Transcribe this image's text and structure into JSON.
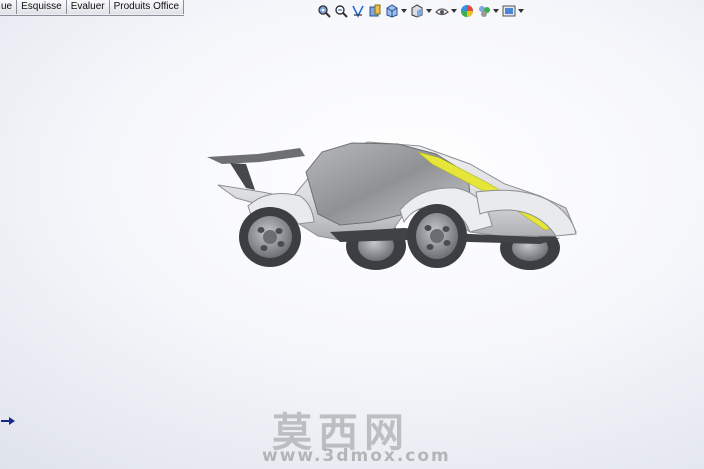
{
  "command_tabs": [
    {
      "label": "ue"
    },
    {
      "label": "Esquisse"
    },
    {
      "label": "Evaluer"
    },
    {
      "label": "Produits Office"
    }
  ],
  "heads_up_toolbar": [
    {
      "icon": "zoom-to-fit-icon"
    },
    {
      "icon": "zoom-to-area-icon"
    },
    {
      "icon": "previous-view-icon"
    },
    {
      "icon": "section-view-icon"
    },
    {
      "icon": "view-orientation-icon",
      "has_dropdown": true
    },
    {
      "icon": "display-style-icon",
      "has_dropdown": true
    },
    {
      "icon": "hide-show-items-icon",
      "has_dropdown": true
    },
    {
      "icon": "edit-appearance-icon"
    },
    {
      "icon": "apply-scene-icon",
      "has_dropdown": true
    },
    {
      "icon": "view-settings-icon",
      "has_dropdown": true
    }
  ],
  "watermark": {
    "chinese": "莫西网",
    "url": "www.3dmox.com"
  },
  "colors": {
    "accent_stripe": "#e6e63a",
    "body_shell": "#d7d8da",
    "tire": "#3c3e42",
    "rim": "#8a8d92"
  }
}
